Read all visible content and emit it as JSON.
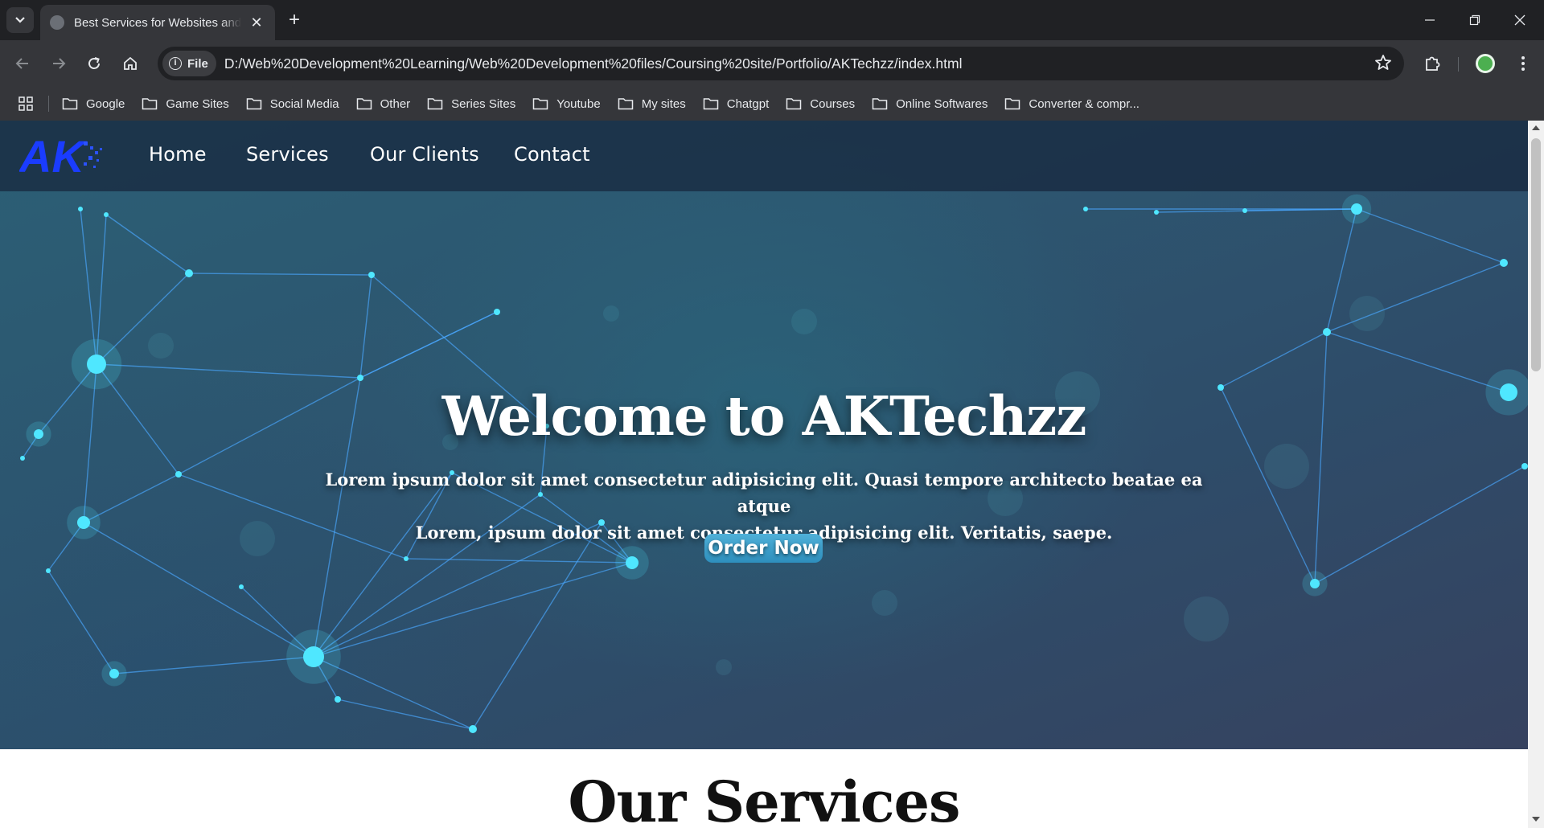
{
  "browser": {
    "tab_title": "Best Services for Websites and Digital",
    "tab_close": "✕",
    "new_tab": "+",
    "file_chip": "File",
    "info_glyph": "i",
    "url": "D:/Web%20Development%20Learning/Web%20Development%20files/Coursing%20site/Portfolio/AKTechzz/index.html",
    "bookmarks": [
      "Google",
      "Game Sites",
      "Social Media",
      "Other",
      "Series Sites",
      "Youtube",
      "My sites",
      "Chatgpt",
      "Courses",
      "Online Softwares",
      "Converter & compr..."
    ]
  },
  "site": {
    "logo_text": "AK",
    "nav": [
      "Home",
      "Services",
      "Our Clients",
      "Contact"
    ],
    "hero": {
      "title": "Welcome to AKTechzz",
      "subtitle_line1": "Lorem ipsum dolor sit amet consectetur adipisicing elit. Quasi tempore architecto beatae ea atque",
      "subtitle_line2": "Lorem, ipsum dolor sit amet consectetur adipisicing elit. Veritatis, saepe.",
      "cta": "Order Now"
    },
    "services_heading": "Our Services"
  },
  "colors": {
    "chrome_dark": "#202124",
    "chrome_mid": "#35363a",
    "logo_blue": "#1a3cff",
    "network_cyan": "#4fe7ff",
    "cta": "#3a9cc8"
  }
}
